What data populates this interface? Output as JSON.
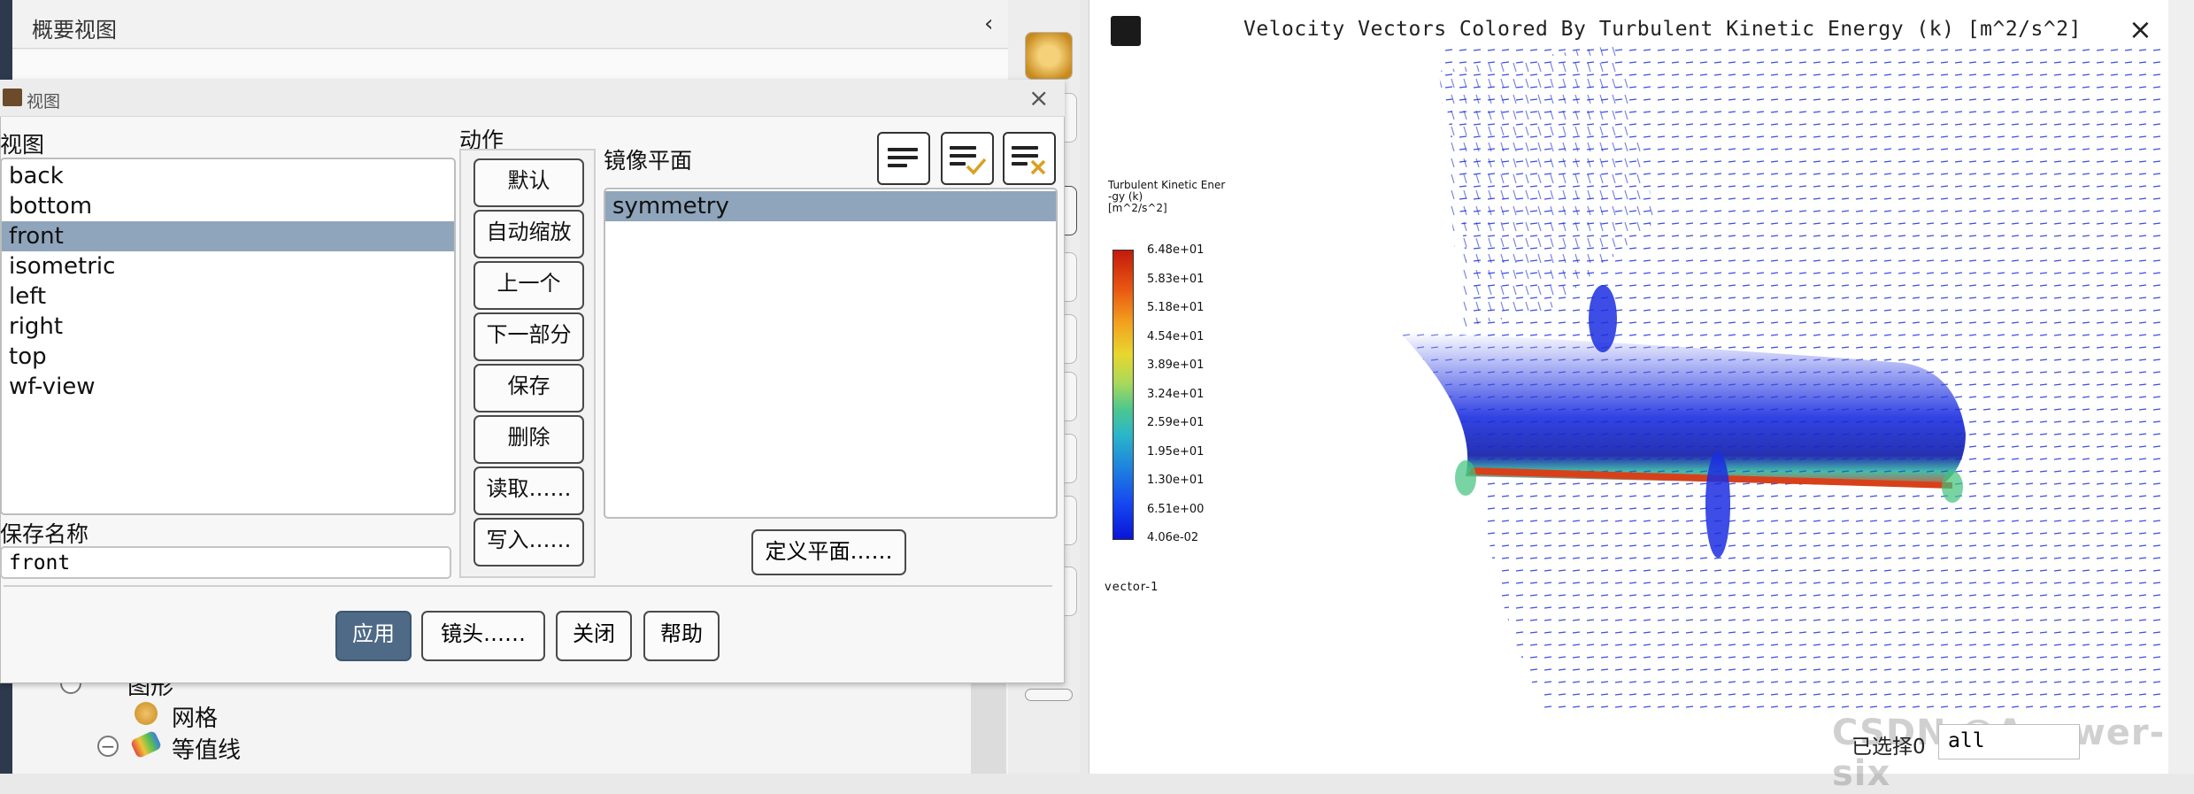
{
  "overview": {
    "title": "概要视图",
    "collapse_icon": "‹"
  },
  "tree": {
    "items": [
      "图形",
      "网格",
      "等值线"
    ]
  },
  "graphics": {
    "title": "Velocity Vectors Colored By Turbulent Kinetic Energy (k) [m^2/s^2]",
    "close": "×",
    "colormap_title": "Turbulent Kinetic Ener\n-gy (k)\n[m^2/s^2]",
    "colormap_labels": [
      "6.48e+01",
      "5.83e+01",
      "5.18e+01",
      "4.54e+01",
      "3.89e+01",
      "3.24e+01",
      "2.59e+01",
      "1.95e+01",
      "1.30e+01",
      "6.51e+00",
      "4.06e-02"
    ],
    "vector_label": "vector-1"
  },
  "dialog": {
    "title": "视图",
    "close": "×",
    "views_label": "视图",
    "views": [
      "back",
      "bottom",
      "front",
      "isometric",
      "left",
      "right",
      "top",
      "wf-view"
    ],
    "selected_view": "front",
    "actions_label": "动作",
    "actions": [
      "默认",
      "自动缩放",
      "上一个",
      "下一部分",
      "保存",
      "删除",
      "读取……",
      "写入……"
    ],
    "mirror_label": "镜像平面",
    "mirror_planes": [
      "symmetry"
    ],
    "save_name_label": "保存名称",
    "save_name_value": "front",
    "define_plane": "定义平面……",
    "apply": "应用",
    "camera": "镜头……",
    "close_btn": "关闭",
    "help": "帮助"
  },
  "status": {
    "selected_label": "已选择0",
    "filter_value": "all"
  },
  "watermark": "CSDN @Answer-six",
  "colors": {
    "accent": "#4e6a86",
    "selection": "#8fa5bb",
    "sidebar_dark": "#2d3a4d"
  }
}
